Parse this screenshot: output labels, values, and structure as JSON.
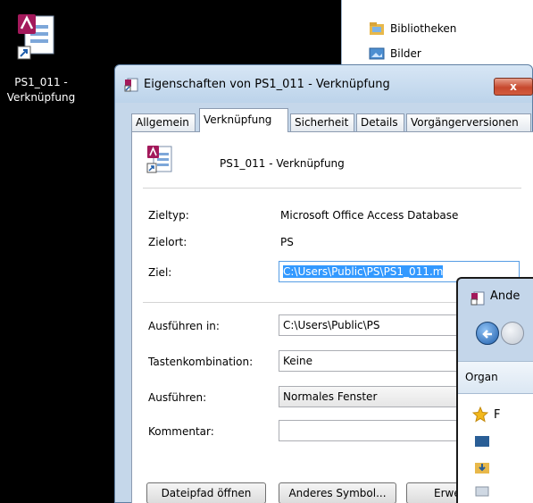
{
  "desktop": {
    "icon_label": "PS1_011 - Verknüpfung"
  },
  "background_explorer": {
    "items": [
      "Bibliotheken",
      "Bilder"
    ]
  },
  "dialog": {
    "title": "Eigenschaften von PS1_011 - Verknüpfung",
    "close_label": "x",
    "tabs": [
      "Allgemein",
      "Verknüpfung",
      "Sicherheit",
      "Details",
      "Vorgängerversionen"
    ],
    "active_tab": "Verknüpfung",
    "file_name": "PS1_011 - Verknüpfung",
    "fields": {
      "zieltyp_label": "Zieltyp:",
      "zieltyp_value": "Microsoft Office Access Database",
      "zielort_label": "Zielort:",
      "zielort_value": "PS",
      "ziel_label": "Ziel:",
      "ziel_value": "C:\\Users\\Public\\PS\\PS1_011.m",
      "ausfuehren_in_label": "Ausführen in:",
      "ausfuehren_in_value": "C:\\Users\\Public\\PS",
      "tastenkombination_label": "Tastenkombination:",
      "tastenkombination_value": "Keine",
      "ausfuehren_label": "Ausführen:",
      "ausfuehren_value": "Normales Fenster",
      "kommentar_label": "Kommentar:",
      "kommentar_value": ""
    },
    "buttons": {
      "open_path": "Dateipfad öffnen",
      "change_icon": "Anderes Symbol...",
      "advanced": "Erwe"
    }
  },
  "foreground_window": {
    "title": "Ande",
    "toolbar_label": "Organ",
    "favorites_label": "F"
  },
  "colors": {
    "selection": "#3399ff",
    "close_button": "#c7492e",
    "titlebar": "#c5d7ea"
  }
}
